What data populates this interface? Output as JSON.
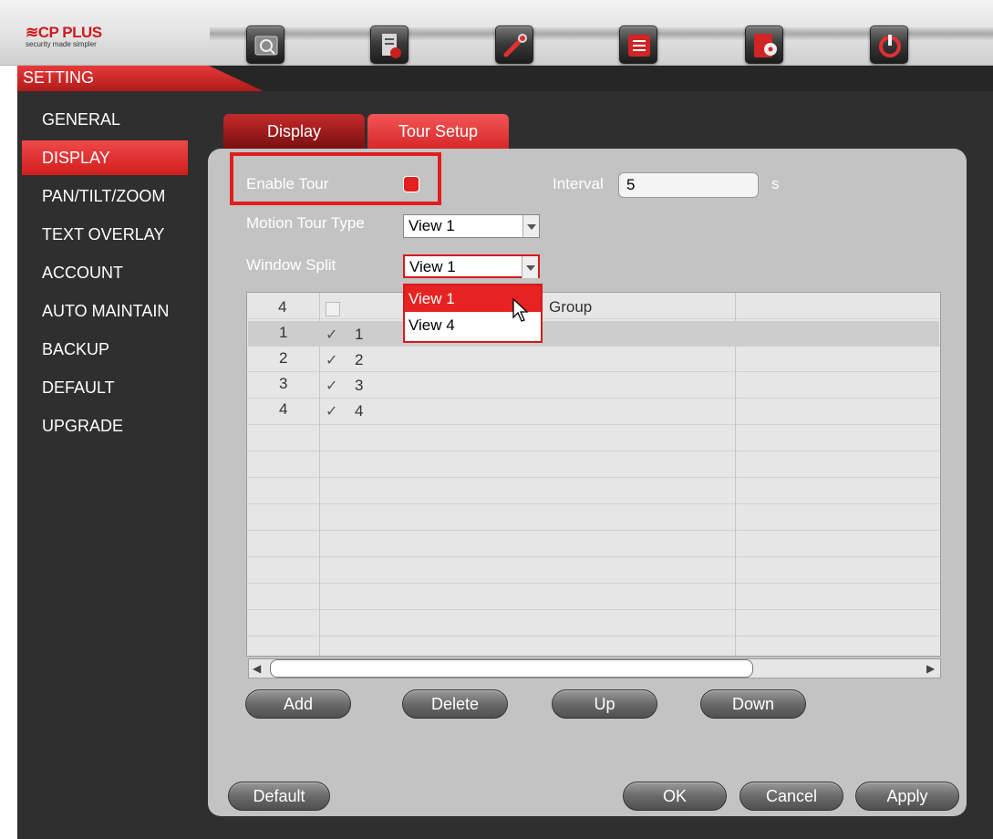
{
  "brand": {
    "logo": "≋CP PLUS",
    "tagline": "security made simpler"
  },
  "toolbar": {
    "icons": [
      "search-camera-icon",
      "document-settings-icon",
      "wrench-icon",
      "list-icon",
      "record-disc-icon",
      "power-icon"
    ]
  },
  "header": {
    "title": "SETTING"
  },
  "sidebar": {
    "items": [
      {
        "label": "GENERAL",
        "active": false
      },
      {
        "label": "DISPLAY",
        "active": true
      },
      {
        "label": "PAN/TILT/ZOOM",
        "active": false
      },
      {
        "label": "TEXT OVERLAY",
        "active": false
      },
      {
        "label": "ACCOUNT",
        "active": false
      },
      {
        "label": "AUTO MAINTAIN",
        "active": false
      },
      {
        "label": "BACKUP",
        "active": false
      },
      {
        "label": "DEFAULT",
        "active": false
      },
      {
        "label": "UPGRADE",
        "active": false
      }
    ]
  },
  "tabs": [
    {
      "label": "Display",
      "active": false
    },
    {
      "label": "Tour Setup",
      "active": true
    }
  ],
  "form": {
    "enable_tour_label": "Enable Tour",
    "enable_tour_checked": true,
    "interval_label": "Interval",
    "interval_value": "5",
    "interval_unit": "s",
    "motion_tour_type_label": "Motion Tour Type",
    "motion_tour_type_value": "View 1",
    "window_split_label": "Window Split",
    "window_split_value": "View 1"
  },
  "dropdown": {
    "options": [
      "View 1",
      "View 4"
    ],
    "highlighted": "View 1"
  },
  "table": {
    "header_count": "4",
    "header_group": "Group",
    "rows": [
      {
        "num": "1",
        "checked": true,
        "group": "1"
      },
      {
        "num": "2",
        "checked": true,
        "group": "2"
      },
      {
        "num": "3",
        "checked": true,
        "group": "3"
      },
      {
        "num": "4",
        "checked": true,
        "group": "4"
      }
    ]
  },
  "buttons": {
    "add": "Add",
    "delete": "Delete",
    "up": "Up",
    "down": "Down",
    "default": "Default",
    "ok": "OK",
    "cancel": "Cancel",
    "apply": "Apply"
  },
  "colors": {
    "accent_red": "#e21d1d",
    "background_dark": "#2f2f2f",
    "panel_gray": "#c3c3c3"
  }
}
